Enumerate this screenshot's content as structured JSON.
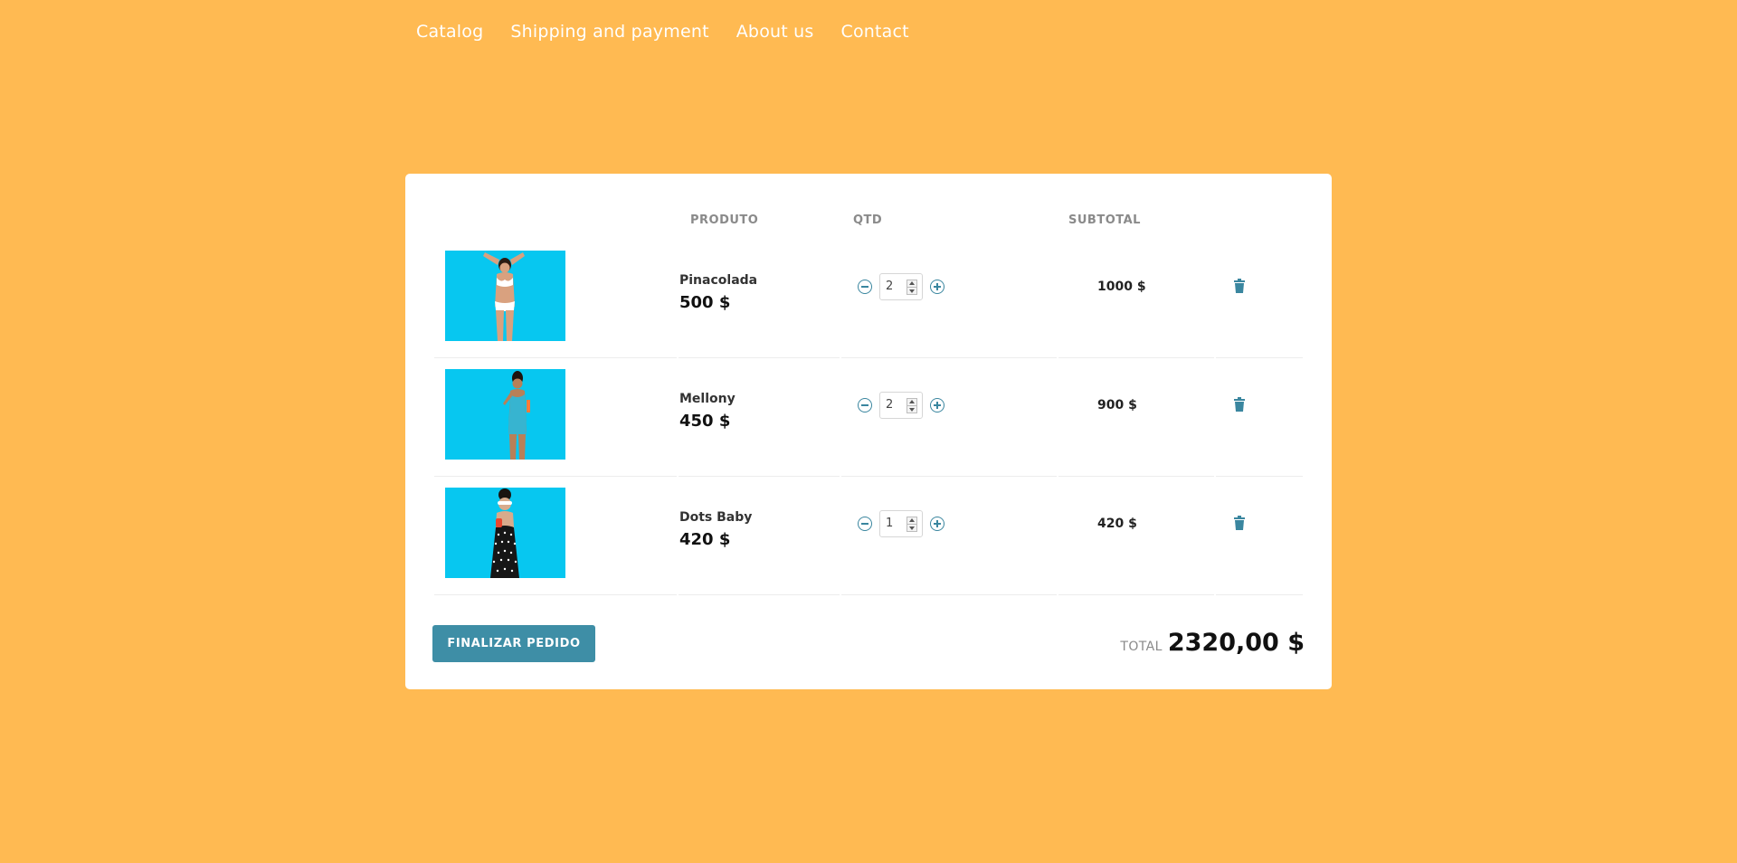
{
  "nav": {
    "items": [
      "Catalog",
      "Shipping and payment",
      "About us",
      "Contact"
    ]
  },
  "cart": {
    "headers": {
      "product": "PRODUTO",
      "qty": "QTD",
      "subtotal": "SUBTOTAL"
    },
    "items": [
      {
        "name": "Pinacolada",
        "price": "500 $",
        "qty": "2",
        "subtotal": "1000 $",
        "swimsuit": "white-bikini",
        "swimsuit_color": "#ffffff",
        "skin": "#d9a17f",
        "hair": "#2b1a12"
      },
      {
        "name": "Mellony",
        "price": "450 $",
        "qty": "2",
        "subtotal": "900 $",
        "swimsuit": "blue-one-piece",
        "swimsuit_color": "#37b4d0",
        "skin": "#b88058",
        "hair": "#1e130d"
      },
      {
        "name": "Dots Baby",
        "price": "420 $",
        "qty": "1",
        "subtotal": "420 $",
        "swimsuit": "black-polka-dot",
        "swimsuit_color": "#161616",
        "skin": "#d8ab8c",
        "hair": "#1a1410"
      }
    ],
    "finish_button": "FINALIZAR PEDIDO",
    "total_label": "TOTAL",
    "total_value": "2320,00 $"
  },
  "colors": {
    "background": "#FFBA52",
    "accent": "#3E8EA6",
    "thumb_bg": "#07C7F0"
  },
  "icons": {
    "minus": "minus-circle-icon",
    "plus": "plus-circle-icon",
    "delete": "trash-icon"
  }
}
